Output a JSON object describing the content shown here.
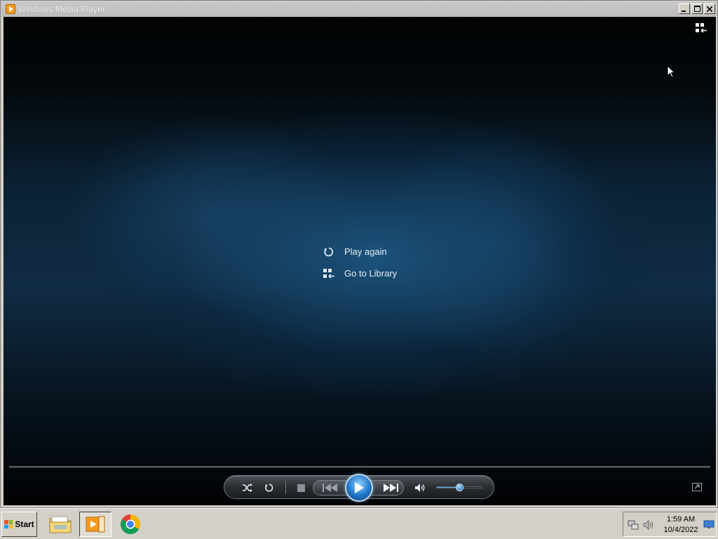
{
  "window": {
    "title": "Windows Media Player",
    "buttons": {
      "minimize": "_",
      "maximize": "□",
      "close": "✕"
    }
  },
  "player": {
    "menu": [
      {
        "label": "Play again",
        "icon": "replay-icon"
      },
      {
        "label": "Go to Library",
        "icon": "library-icon"
      }
    ],
    "controls": {
      "shuffle": "shuffle-icon",
      "repeat": "repeat-icon",
      "stop": "stop-icon",
      "previous": "previous-icon",
      "play": "play-icon",
      "next": "next-icon",
      "mute": "volume-icon",
      "volume_level": 0.5
    },
    "accent": "#2b86d8"
  },
  "taskbar": {
    "start_label": "Start",
    "items": [
      "file-explorer-icon",
      "media-player-icon",
      "chrome-icon"
    ],
    "clock_time": "1:59 AM",
    "clock_date": "10/4/2022"
  }
}
